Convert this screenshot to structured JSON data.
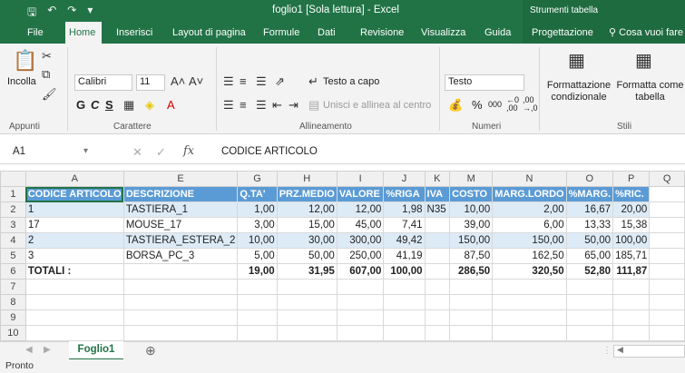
{
  "window": {
    "title": "foglio1  [Sola lettura]  -  Excel",
    "context_header": "Strumenti tabella"
  },
  "tabs": [
    "File",
    "Home",
    "Inserisci",
    "Layout di pagina",
    "Formule",
    "Dati",
    "Revisione",
    "Visualizza",
    "Guida",
    "Progettazione",
    "Cosa vuoi fare"
  ],
  "ribbon": {
    "clipboard": {
      "paste_label": "Incolla",
      "group": "Appunti"
    },
    "font": {
      "name": "Calibri",
      "size": "11",
      "bold": "G",
      "italic": "C",
      "underline": "S",
      "group": "Carattere"
    },
    "alignment": {
      "wrap": "Testo a capo",
      "merge": "Unisci e allinea al centro",
      "group": "Allineamento"
    },
    "number": {
      "format": "Testo",
      "percent": "%",
      "thousands": "000",
      "group": "Numeri"
    },
    "styles": {
      "conditional": "Formattazione condizionale",
      "as_table": "Formatta come tabella",
      "group": "Stili"
    }
  },
  "formula_bar": {
    "cell_ref": "A1",
    "fx": "fx",
    "content": "CODICE ARTICOLO"
  },
  "grid": {
    "columns": [
      "A",
      "E",
      "G",
      "H",
      "I",
      "J",
      "K",
      "M",
      "N",
      "O",
      "P",
      "Q"
    ],
    "header_row": [
      "CODICE ARTICOLO",
      "DESCRIZIONE",
      "Q.TA'",
      "PRZ.MEDIO",
      "VALORE",
      "%RIGA",
      "IVA",
      "COSTO",
      "MARG.LORDO",
      "%MARG.",
      "%RIC.",
      ""
    ],
    "rows": [
      [
        "1",
        "TASTIERA_1",
        "1,00",
        "12,00",
        "12,00",
        "1,98",
        "N35",
        "10,00",
        "2,00",
        "16,67",
        "20,00",
        ""
      ],
      [
        "17",
        "MOUSE_17",
        "3,00",
        "15,00",
        "45,00",
        "7,41",
        "",
        "39,00",
        "6,00",
        "13,33",
        "15,38",
        ""
      ],
      [
        "2",
        "TASTIERA_ESTERA_2",
        "10,00",
        "30,00",
        "300,00",
        "49,42",
        "",
        "150,00",
        "150,00",
        "50,00",
        "100,00",
        ""
      ],
      [
        "3",
        "BORSA_PC_3",
        "5,00",
        "50,00",
        "250,00",
        "41,19",
        "",
        "87,50",
        "162,50",
        "65,00",
        "185,71",
        ""
      ]
    ],
    "totals_row": [
      "TOTALI :",
      "",
      "19,00",
      "31,95",
      "607,00",
      "100,00",
      "",
      "286,50",
      "320,50",
      "52,80",
      "111,87",
      ""
    ],
    "row_numbers": [
      "1",
      "2",
      "3",
      "4",
      "5",
      "6",
      "7",
      "8",
      "9",
      "10"
    ]
  },
  "sheet_tab": "Foglio1",
  "status": "Pronto"
}
